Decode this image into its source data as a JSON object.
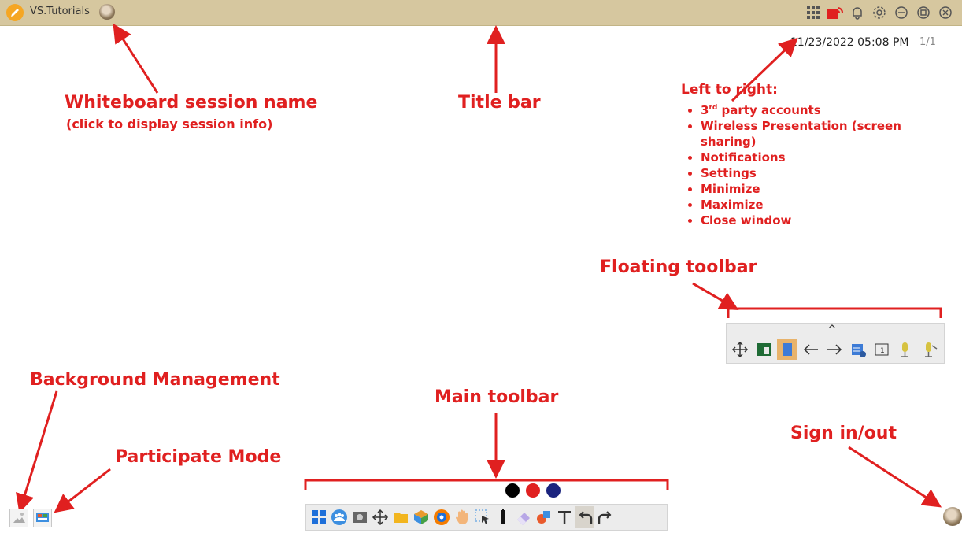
{
  "titlebar": {
    "session_name": "VS.Tutorials",
    "icons": [
      "apps-grid-icon",
      "wireless-presentation-icon",
      "bell-icon",
      "gear-icon",
      "minimize-icon",
      "maximize-icon",
      "close-icon"
    ]
  },
  "status": {
    "datetime": "11/23/2022 05:08 PM",
    "page": "1/1"
  },
  "annotations": {
    "session_name": "Whiteboard session name",
    "session_name_sub": "(click to display session info)",
    "title_bar": "Title bar",
    "left_to_right": "Left to right:",
    "bullets": [
      "3rd party accounts",
      "Wireless Presentation (screen sharing)",
      "Notifications",
      "Settings",
      "Minimize",
      "Maximize",
      "Close window"
    ],
    "floating_toolbar": "Floating toolbar",
    "background_management": "Background Management",
    "participate_mode": "Participate Mode",
    "main_toolbar": "Main toolbar",
    "sign_in_out": "Sign in/out"
  },
  "floating_toolbar": {
    "chevron": "^",
    "icons": [
      "move-icon",
      "board-icon",
      "page-icon",
      "arrow-left-icon",
      "arrow-right-icon",
      "add-page-icon",
      "page-number-icon",
      "mic-icon",
      "mic-mute-icon"
    ]
  },
  "main_toolbar": {
    "pen_colors": [
      "#000000",
      "#e02020",
      "#1a237e"
    ],
    "icons": [
      "windows-icon",
      "users-icon",
      "screenshot-icon",
      "move-icon",
      "folder-icon",
      "box-icon",
      "browser-icon",
      "hand-icon",
      "select-icon",
      "marker-icon",
      "eraser-icon",
      "shape-icon",
      "text-icon",
      "undo-icon",
      "redo-icon"
    ]
  },
  "colors": {
    "accent": "#e02020",
    "titlebar": "#d6c79f",
    "toolbar": "#ececec"
  }
}
